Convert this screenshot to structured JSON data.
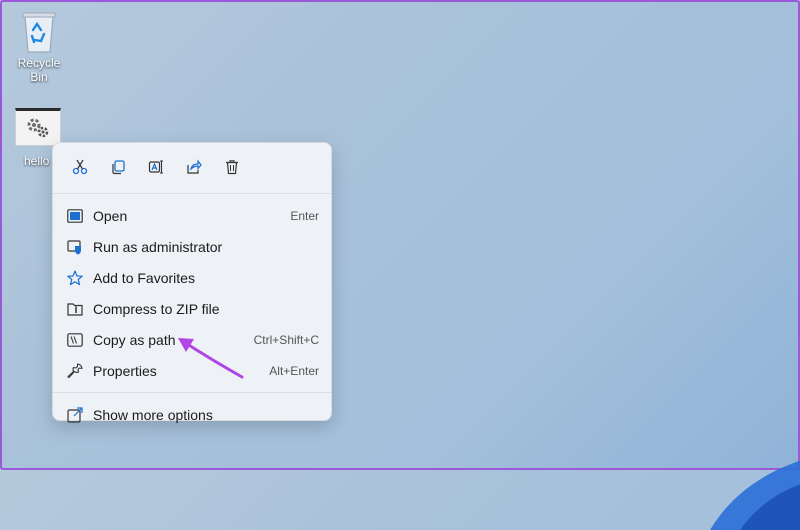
{
  "desktop": {
    "recycle_bin_label": "Recycle Bin",
    "file_label": "hello"
  },
  "context_menu": {
    "toolbar_icons": [
      "cut-icon",
      "copy-icon",
      "rename-icon",
      "share-icon",
      "delete-icon"
    ],
    "items": [
      {
        "label": "Open",
        "shortcut": "Enter",
        "icon": "open-icon"
      },
      {
        "label": "Run as administrator",
        "shortcut": "",
        "icon": "shield-icon"
      },
      {
        "label": "Add to Favorites",
        "shortcut": "",
        "icon": "star-icon"
      },
      {
        "label": "Compress to ZIP file",
        "shortcut": "",
        "icon": "zip-folder-icon"
      },
      {
        "label": "Copy as path",
        "shortcut": "Ctrl+Shift+C",
        "icon": "copy-path-icon"
      },
      {
        "label": "Properties",
        "shortcut": "Alt+Enter",
        "icon": "wrench-icon"
      }
    ],
    "more_options_label": "Show more options"
  },
  "colors": {
    "accent_arrow": "#b145e6",
    "frame": "#9b59d9",
    "icon_blue": "#1a6fd0"
  }
}
